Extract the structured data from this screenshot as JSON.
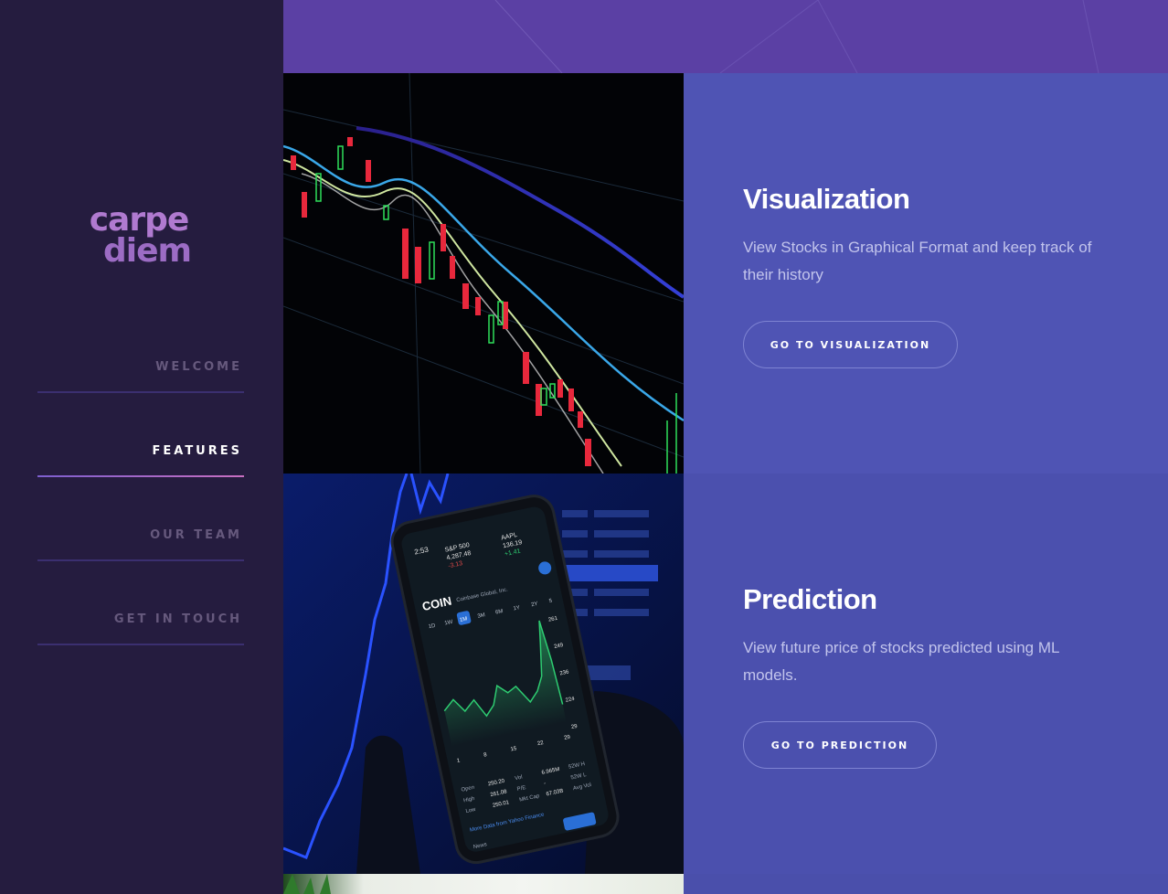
{
  "logo": {
    "line1": "carpe",
    "line2": "diem"
  },
  "nav": {
    "items": [
      {
        "label": "WELCOME",
        "active": false
      },
      {
        "label": "FEATURES",
        "active": true
      },
      {
        "label": "OUR TEAM",
        "active": false
      },
      {
        "label": "GET IN TOUCH",
        "active": false
      }
    ]
  },
  "features": [
    {
      "title": "Visualization",
      "description": "View Stocks in Graphical Format and keep track of their history",
      "button": "GO TO VISUALIZATION"
    },
    {
      "title": "Prediction",
      "description": "View future price of stocks predicted using ML models.",
      "button": "GO TO PREDICTION"
    }
  ],
  "phone": {
    "time": "2:53",
    "index_name": "S&P 500",
    "index_value": "4,287.48",
    "index_change": "-3.13",
    "stock_symbol": "AAPL",
    "stock_value": "136.19",
    "stock_change": "+1.41",
    "ticker": "COIN",
    "company": "Coinbase Global, Inc.",
    "ranges": [
      "1D",
      "1W",
      "1M",
      "3M",
      "6M",
      "1Y",
      "2Y",
      "5"
    ],
    "y_ticks": [
      "261",
      "249",
      "236",
      "224",
      "29"
    ],
    "x_ticks": [
      "1",
      "8",
      "15",
      "22",
      "29"
    ],
    "stats": [
      {
        "label": "Open",
        "value": "250.20"
      },
      {
        "label": "High",
        "value": "261.08"
      },
      {
        "label": "Low",
        "value": "250.01"
      }
    ],
    "stats2": [
      {
        "label": "Vol",
        "value": "6.965M"
      },
      {
        "label": "P/E",
        "value": "-"
      },
      {
        "label": "Mkt Cap",
        "value": "67.03B"
      }
    ],
    "stats3": [
      "52W H",
      "52W L",
      "Avg Vol"
    ],
    "more_data": "More Data from Yahoo Finance",
    "news": "News"
  },
  "colors": {
    "sidebar_bg": "#251c3f",
    "top_band": "#5b40a4",
    "panel_bg": "#4f54b4",
    "logo": "#b07ad0",
    "nav_active": "#ffffff",
    "nav_inactive": "#66597d"
  }
}
